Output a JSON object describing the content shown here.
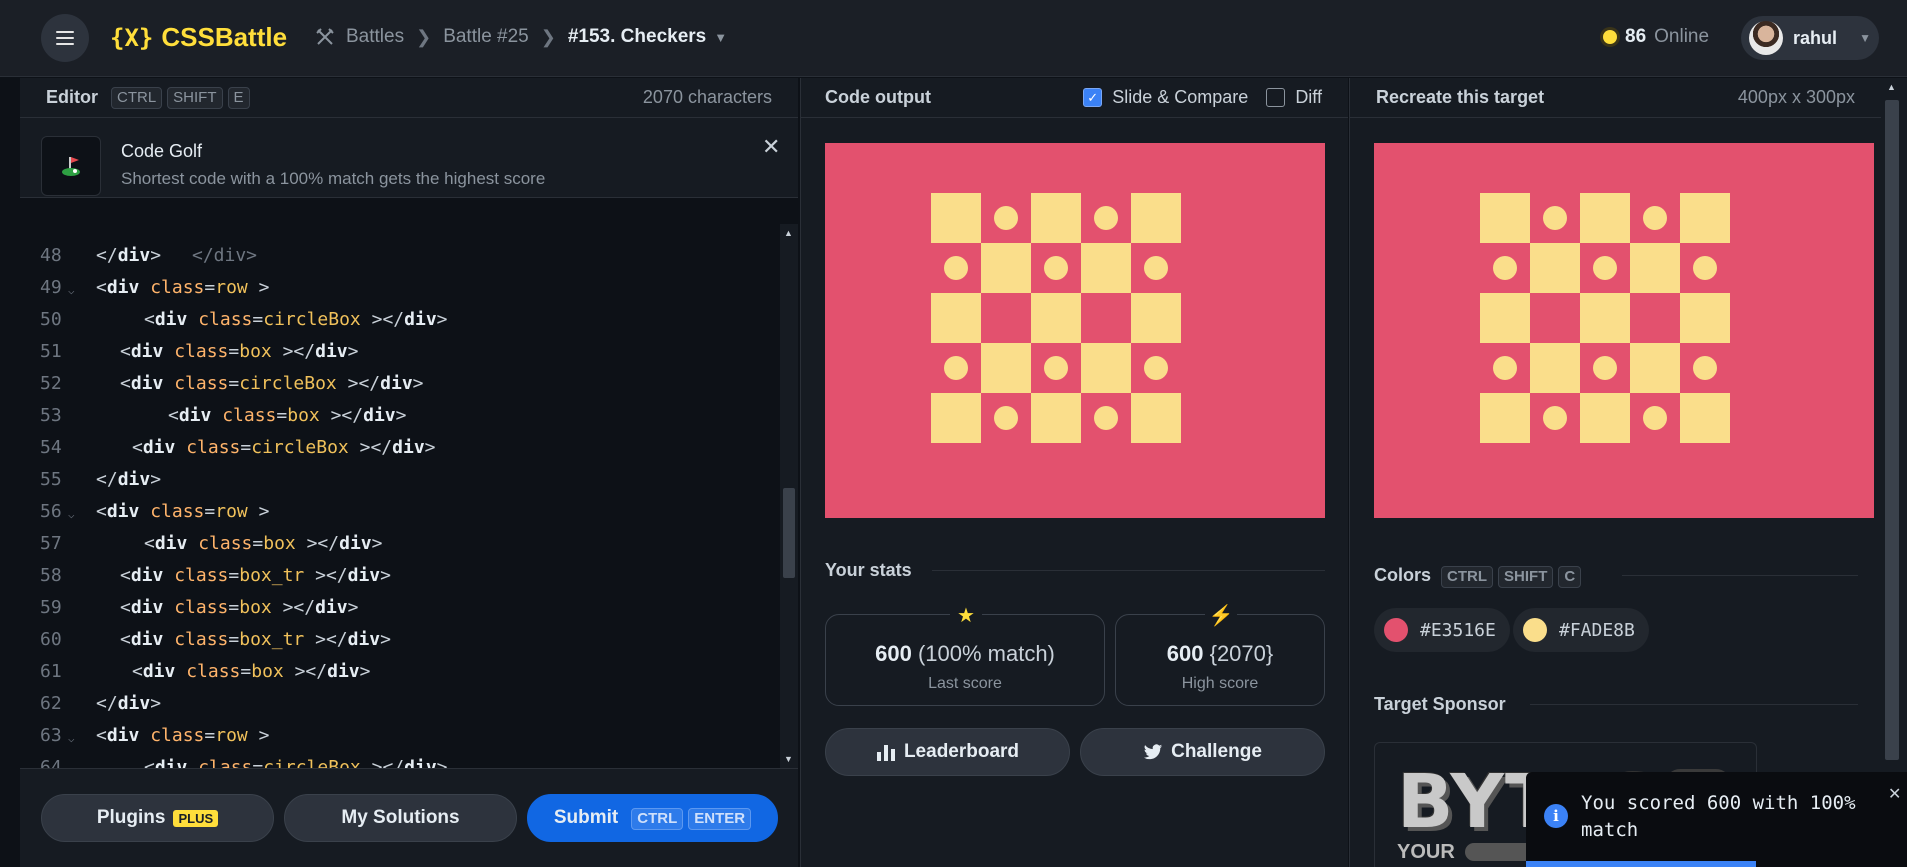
{
  "topbar": {
    "logo_mark": "{X}",
    "logo_text": "CSSBattle",
    "crumbs": [
      "Battles",
      "Battle #25",
      "#153. Checkers"
    ],
    "online_count": "86",
    "online_label": "Online",
    "user_name": "rahul"
  },
  "editor": {
    "title": "Editor",
    "shortcut": [
      "CTRL",
      "SHIFT",
      "E"
    ],
    "char_count": "2070 characters",
    "golf_title": "Code Golf",
    "golf_desc": "Shortest code with a 100% match gets the highest score",
    "lines": [
      {
        "n": "48",
        "indent": 0,
        "fold": false,
        "cls": "",
        "close": true
      },
      {
        "n": "49",
        "indent": 0,
        "fold": true,
        "cls": "row",
        "close": false
      },
      {
        "n": "50",
        "indent": 2,
        "fold": false,
        "cls": "circleBox",
        "close": false
      },
      {
        "n": "51",
        "indent": 1,
        "fold": false,
        "cls": "box",
        "close": false
      },
      {
        "n": "52",
        "indent": 1,
        "fold": false,
        "cls": "circleBox",
        "close": false
      },
      {
        "n": "53",
        "indent": 3,
        "fold": false,
        "cls": "box",
        "close": false
      },
      {
        "n": "54",
        "indent": 1.5,
        "fold": false,
        "cls": "circleBox",
        "close": false
      },
      {
        "n": "55",
        "indent": 0,
        "fold": false,
        "cls": "",
        "close": true
      },
      {
        "n": "56",
        "indent": 0,
        "fold": true,
        "cls": "row",
        "close": false
      },
      {
        "n": "57",
        "indent": 2,
        "fold": false,
        "cls": "box",
        "close": false
      },
      {
        "n": "58",
        "indent": 1,
        "fold": false,
        "cls": "box_tr",
        "close": false
      },
      {
        "n": "59",
        "indent": 1,
        "fold": false,
        "cls": "box",
        "close": false
      },
      {
        "n": "60",
        "indent": 1,
        "fold": false,
        "cls": "box_tr",
        "close": false
      },
      {
        "n": "61",
        "indent": 1.5,
        "fold": false,
        "cls": "box",
        "close": false
      },
      {
        "n": "62",
        "indent": 0,
        "fold": false,
        "cls": "",
        "close": true
      },
      {
        "n": "63",
        "indent": 0,
        "fold": true,
        "cls": "row",
        "close": false
      },
      {
        "n": "64",
        "indent": 2,
        "fold": false,
        "cls": "circleBox",
        "close": false
      }
    ],
    "footer": {
      "plugins_label": "Plugins",
      "plus_badge": "PLUS",
      "solutions_label": "My Solutions",
      "submit_label": "Submit",
      "submit_keys": [
        "CTRL",
        "ENTER"
      ]
    }
  },
  "output": {
    "title": "Code output",
    "slide_compare_label": "Slide & Compare",
    "slide_compare_checked": true,
    "diff_label": "Diff",
    "diff_checked": false,
    "stats_title": "Your stats",
    "last_score_value": "600",
    "last_score_extra": "(100% match)",
    "last_score_label": "Last score",
    "high_score_value": "600",
    "high_score_extra": "{2070}",
    "high_score_label": "High score",
    "leaderboard_label": "Leaderboard",
    "challenge_label": "Challenge"
  },
  "target": {
    "title": "Recreate this target",
    "dims": "400px x 300px",
    "colors_title": "Colors",
    "colors_keys": [
      "CTRL",
      "SHIFT",
      "C"
    ],
    "colors": [
      "#E3516E",
      "#FADE8B"
    ],
    "sponsor_title": "Target Sponsor",
    "sponsor_logo": "BYTES",
    "sponsor_tag": "YOUR"
  },
  "toast": {
    "message": "You scored 600 with 100% match"
  },
  "colors": {
    "background": "#E3516E",
    "pattern": "#FADE8B",
    "brand": "#ffde3b",
    "accent": "#1167e3"
  }
}
